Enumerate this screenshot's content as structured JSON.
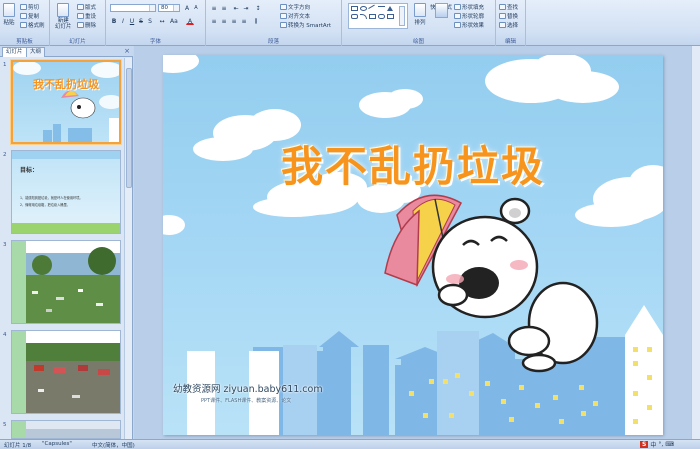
{
  "ribbon": {
    "clipboard": {
      "label": "剪贴板",
      "paste": "粘贴",
      "cut": "剪切",
      "copy": "复制",
      "format_painter": "格式刷"
    },
    "slides": {
      "label": "幻灯片",
      "new_slide": "新建\n幻灯片",
      "layout": "版式",
      "reset": "重设",
      "delete": "删除"
    },
    "font": {
      "label": "字体",
      "font_size": "80"
    },
    "paragraph": {
      "label": "段落",
      "text_direction": "文字方向",
      "align_text": "对齐文本",
      "smartart": "转换为 SmartArt"
    },
    "drawing": {
      "label": "绘图",
      "arrange": "排列",
      "quick_styles": "快速样式",
      "shape_fill": "形状填充",
      "shape_outline": "形状轮廓",
      "shape_effects": "形状效果"
    },
    "editing": {
      "label": "编辑",
      "find": "查找",
      "replace": "替换",
      "select": "选择"
    }
  },
  "panel": {
    "tab_slides": "幻灯片",
    "tab_outline": "大纲",
    "close": "×",
    "thumbnails": [
      {
        "num": "1",
        "title": "我不乱扔垃圾"
      },
      {
        "num": "2",
        "heading": "目标：",
        "line1": "1、能感知到脏垃圾，就是坏人在使用环境。",
        "line2": "2、懂得用垃圾箱，把垃圾入桶里。"
      },
      {
        "num": "3"
      },
      {
        "num": "4"
      },
      {
        "num": "5"
      }
    ]
  },
  "slide": {
    "title": "我不乱扔垃圾",
    "watermark": "幼教资源网 ziyuan.baby611.com",
    "watermark_sub": "PPT课件、FLASH课件、教案资源、论文"
  },
  "status": {
    "slide_count": "幻灯片 1/8",
    "theme": "\"Capsules\"",
    "language": "中文(简体，中国)",
    "ime_label": "S",
    "ime_mode": "中"
  },
  "colors": {
    "title_orange": "#f7941d",
    "sky": "#a6d8f5",
    "building_blue": "#7fb7e6",
    "umbrella_pink": "#e98a9e",
    "umbrella_yellow": "#f6d24a"
  }
}
